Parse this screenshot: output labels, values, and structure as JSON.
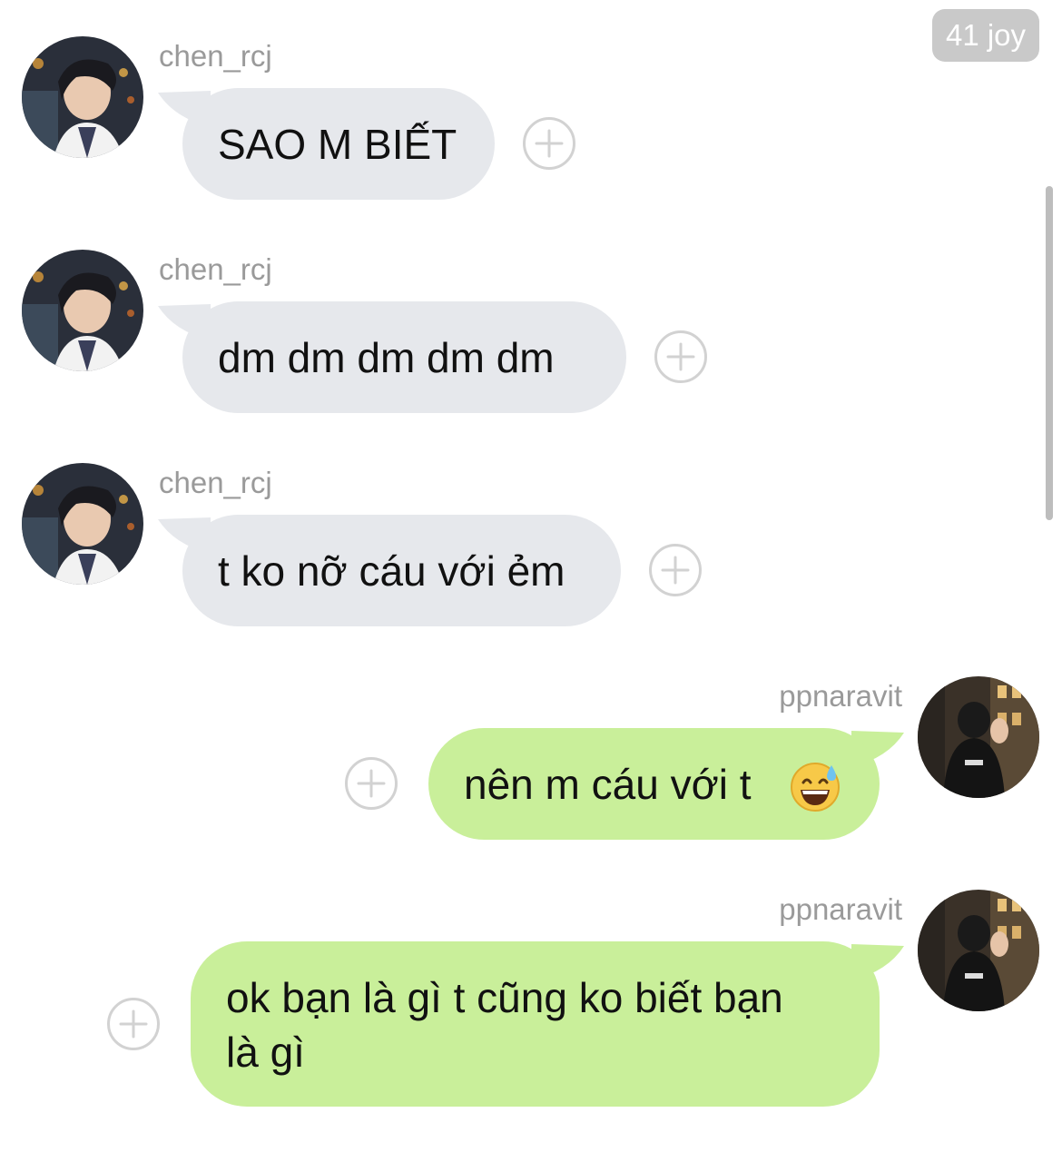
{
  "header": {
    "badge_text": "41 joy"
  },
  "icons": {
    "react": "plus-icon",
    "emoji": "sweat-smile-emoji"
  },
  "colors": {
    "incoming_bubble": "#e6e8ec",
    "outgoing_bubble": "#c9ef9a",
    "sender_name": "#9a9a9a",
    "badge": "#c9c9c9"
  },
  "messages": [
    {
      "sender": "chen_rcj",
      "direction": "incoming",
      "text": "SAO M BIẾT"
    },
    {
      "sender": "chen_rcj",
      "direction": "incoming",
      "text": "dm dm dm dm dm"
    },
    {
      "sender": "chen_rcj",
      "direction": "incoming",
      "text": "t ko nỡ cáu với ẻm"
    },
    {
      "sender": "ppnaravit",
      "direction": "outgoing",
      "text": "nên m cáu với t"
    },
    {
      "sender": "ppnaravit",
      "direction": "outgoing",
      "text": "ok bạn là gì t cũng ko biết bạn là gì"
    }
  ]
}
